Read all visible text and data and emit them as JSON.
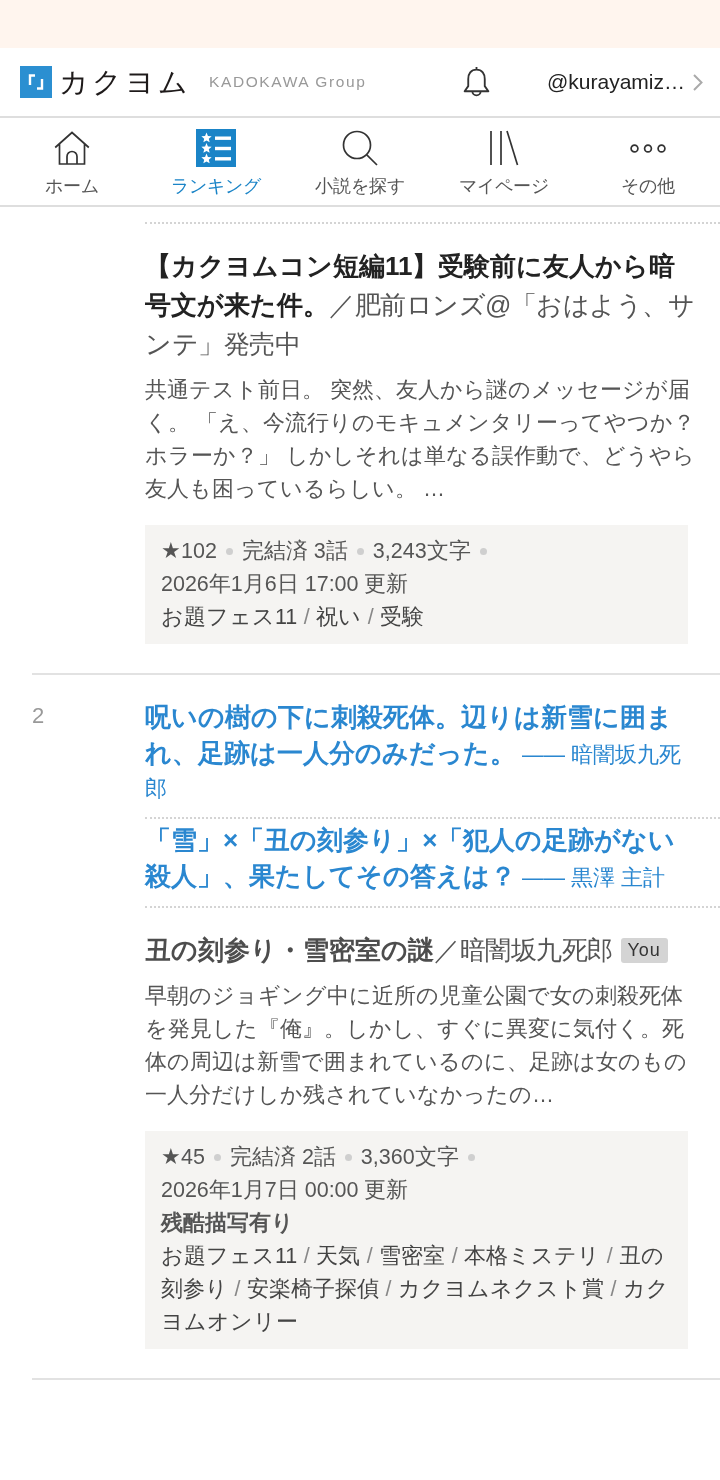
{
  "header": {
    "logo_text": "カクヨム",
    "group_label": "KADOKAWA Group",
    "username": "@kurayamiz…"
  },
  "nav": {
    "items": [
      {
        "label": "ホーム",
        "selected": false
      },
      {
        "label": "ランキング",
        "selected": true
      },
      {
        "label": "小説を探す",
        "selected": false
      },
      {
        "label": "マイページ",
        "selected": false
      },
      {
        "label": "その他",
        "selected": false
      }
    ]
  },
  "works": [
    {
      "title": "**【カクヨムコン短編11】受験前に友人から暗号文が来た件。**／肥前ロンズ@「おはよう、サンテ」発売中",
      "visited": false,
      "description": "共通テスト前日。 突然、友人から謎のメッセージが届く。 「え、今流行りのモキュメンタリーってやつか？ホラーか？」 しかしそれは単なる誤作動で、どうやら友人も困っているらしい。 …",
      "stats": [
        "★102",
        "完結済 3話",
        "3,243文字"
      ],
      "updated": "2026年1月6日 17:00 更新",
      "tags": [
        "お題フェス11",
        "祝い",
        "受験"
      ],
      "tag_separator": "/"
    },
    {
      "rank": "2",
      "reviews": [
        {
          "text": "**呪いの樹の下に刺殺死体。辺りは新雪に囲まれ、足跡は一人分のみだった。** ―― 暗闇坂九死郎"
        },
        {
          "text": "**「雪」×「丑の刻参り」×「犯人の足跡がない殺人」、果たしてその答えは？** ―― 黒澤 主計"
        }
      ],
      "title": "**丑の刻参り・雪密室の謎**／暗闇坂九死郎",
      "badge": "You",
      "visited": true,
      "description": "早朝のジョギング中に近所の児童公園で女の刺殺死体を発見した『俺』。しかし、すぐに異変に気付く。死体の周辺は新雪で囲まれているのに、足跡は女のもの一人分だけしか残されていなかったの…",
      "stats": [
        "★45",
        "完結済 2話",
        "3,360文字"
      ],
      "updated": "2026年1月7日 00:00 更新",
      "warning": "残酷描写有り",
      "tags": [
        "お題フェス11",
        "天気",
        "雪密室",
        "本格ミステリ",
        "丑の刻参り",
        "安楽椅子探偵",
        "カクヨムネクスト賞",
        "カクヨムオンリー"
      ],
      "tag_separator": "/"
    }
  ]
}
